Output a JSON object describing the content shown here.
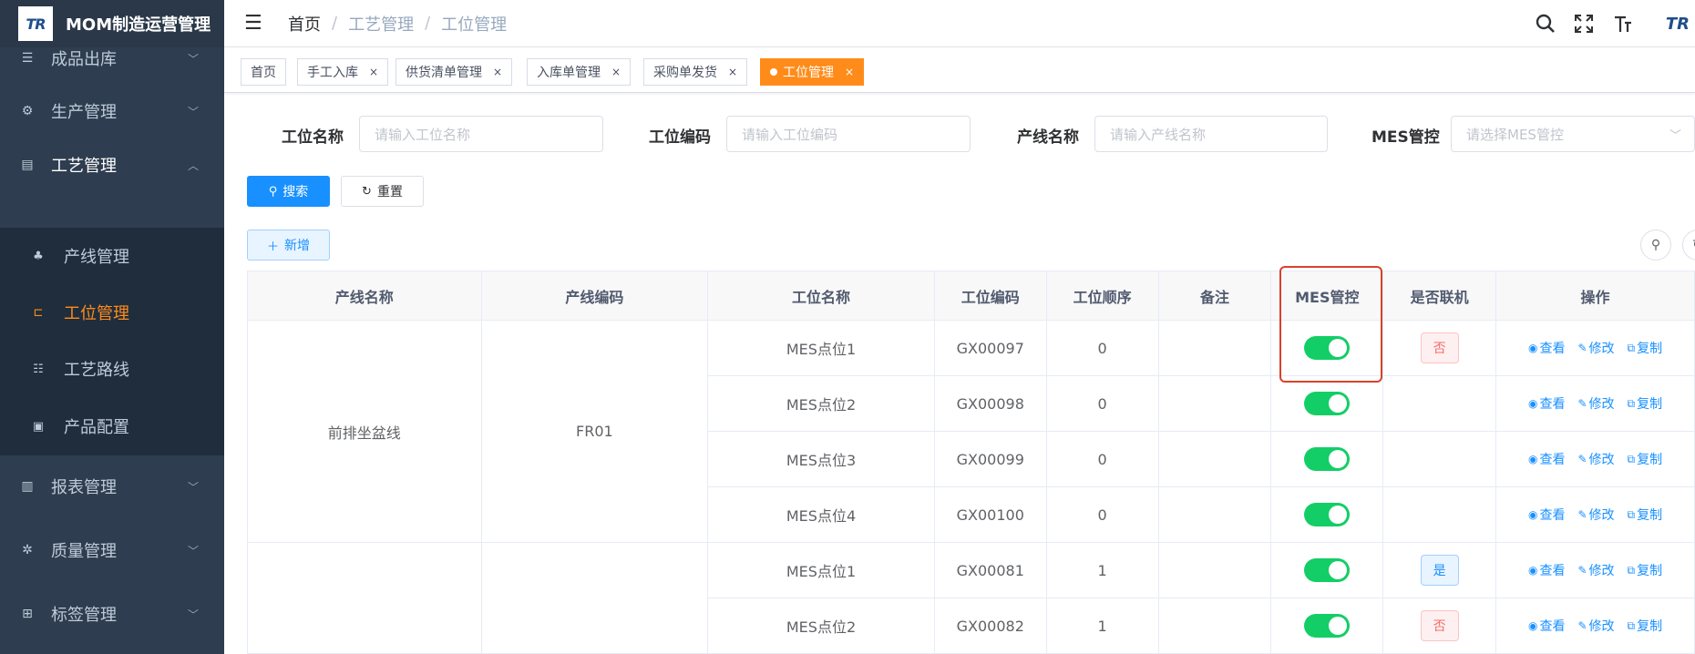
{
  "app": {
    "title": "MOM制造运营管理",
    "logo_text": "TR"
  },
  "sidebar": {
    "items": [
      {
        "label": "成品出库",
        "icon": "list-icon"
      },
      {
        "label": "生产管理",
        "icon": "gear-box-icon"
      },
      {
        "label": "工艺管理",
        "icon": "card-icon"
      },
      {
        "label": "报表管理",
        "icon": "report-icon"
      },
      {
        "label": "质量管理",
        "icon": "bug-icon"
      },
      {
        "label": "标签管理",
        "icon": "table-icon"
      }
    ],
    "subitems": [
      {
        "label": "产线管理",
        "icon": "tree-icon"
      },
      {
        "label": "工位管理",
        "icon": "branch-icon"
      },
      {
        "label": "工艺路线",
        "icon": "route-icon"
      },
      {
        "label": "产品配置",
        "icon": "image-icon"
      }
    ]
  },
  "breadcrumb": [
    "首页",
    "工艺管理",
    "工位管理"
  ],
  "header": {
    "logo_text": "TR"
  },
  "tags": [
    {
      "label": "首页"
    },
    {
      "label": "手工入库"
    },
    {
      "label": "供货清单管理"
    },
    {
      "label": "入库单管理"
    },
    {
      "label": "采购单发货"
    },
    {
      "label": "工位管理"
    }
  ],
  "search": {
    "station_name": {
      "label": "工位名称",
      "placeholder": "请输入工位名称"
    },
    "station_code": {
      "label": "工位编码",
      "placeholder": "请输入工位编码"
    },
    "line_name": {
      "label": "产线名称",
      "placeholder": "请输入产线名称"
    },
    "mes_control": {
      "label": "MES管控",
      "placeholder": "请选择MES管控"
    },
    "search_label": "搜索",
    "reset_label": "重置",
    "add_label": "新增"
  },
  "table": {
    "columns": [
      "产线名称",
      "产线编码",
      "工位名称",
      "工位编码",
      "工位顺序",
      "备注",
      "MES管控",
      "是否联机",
      "操作"
    ],
    "group1": {
      "line_name": "前排坐盆线",
      "line_code": "FR01"
    },
    "group2": {
      "line_name": "",
      "line_code": ""
    },
    "rows": [
      {
        "station": "MES点位1",
        "code": "GX00097",
        "order": "0",
        "note": "",
        "mes": true,
        "online": "否"
      },
      {
        "station": "MES点位2",
        "code": "GX00098",
        "order": "0",
        "note": "",
        "mes": true,
        "online": ""
      },
      {
        "station": "MES点位3",
        "code": "GX00099",
        "order": "0",
        "note": "",
        "mes": true,
        "online": ""
      },
      {
        "station": "MES点位4",
        "code": "GX00100",
        "order": "0",
        "note": "",
        "mes": true,
        "online": ""
      },
      {
        "station": "MES点位1",
        "code": "GX00081",
        "order": "1",
        "note": "",
        "mes": true,
        "online": "是"
      },
      {
        "station": "MES点位2",
        "code": "GX00082",
        "order": "1",
        "note": "",
        "mes": true,
        "online": "否"
      }
    ],
    "actions": {
      "view": "查看",
      "edit": "修改",
      "copy": "复制"
    }
  },
  "colors": {
    "accent": "#ff8c1a",
    "primary": "#1890ff",
    "sidebar": "#2f3d50",
    "switch_on": "#13ce66",
    "highlight": "#d9412c"
  }
}
